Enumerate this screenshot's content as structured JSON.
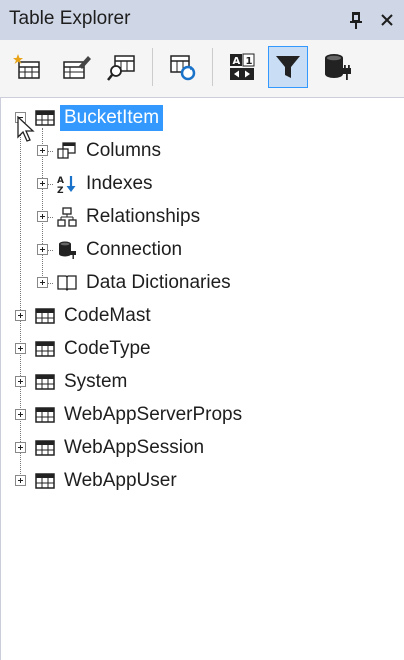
{
  "window": {
    "title": "Table Explorer"
  },
  "titlebar": {
    "pin_icon": "pin-icon",
    "close_icon": "close-icon"
  },
  "toolbar": {
    "buttons": [
      {
        "name": "new-table-button",
        "icon": "new-table-icon"
      },
      {
        "name": "edit-table-button",
        "icon": "edit-table-icon"
      },
      {
        "name": "query-table-button",
        "icon": "query-table-icon"
      },
      {
        "name": "refresh-tables-button",
        "icon": "refresh-table-icon"
      },
      {
        "name": "sort-alpha-button",
        "icon": "sort-alphabetical-icon"
      },
      {
        "name": "filter-button",
        "icon": "filter-icon",
        "active": true
      },
      {
        "name": "connection-button",
        "icon": "database-connect-icon"
      }
    ]
  },
  "tree": {
    "root": {
      "label": "BucketItem",
      "expanded": true,
      "selected": true
    },
    "children": [
      {
        "label": "Columns",
        "icon": "columns-icon"
      },
      {
        "label": "Indexes",
        "icon": "indexes-icon"
      },
      {
        "label": "Relationships",
        "icon": "relationships-icon"
      },
      {
        "label": "Connection",
        "icon": "connection-icon"
      },
      {
        "label": "Data Dictionaries",
        "icon": "data-dictionaries-icon"
      }
    ],
    "tables": [
      {
        "label": "CodeMast"
      },
      {
        "label": "CodeType"
      },
      {
        "label": "System"
      },
      {
        "label": "WebAppServerProps"
      },
      {
        "label": "WebAppSession"
      },
      {
        "label": "WebAppUser"
      }
    ]
  },
  "colors": {
    "selection": "#3399ff",
    "titlebar": "#cfd6e5",
    "toolbar_active": "#c9def5"
  }
}
